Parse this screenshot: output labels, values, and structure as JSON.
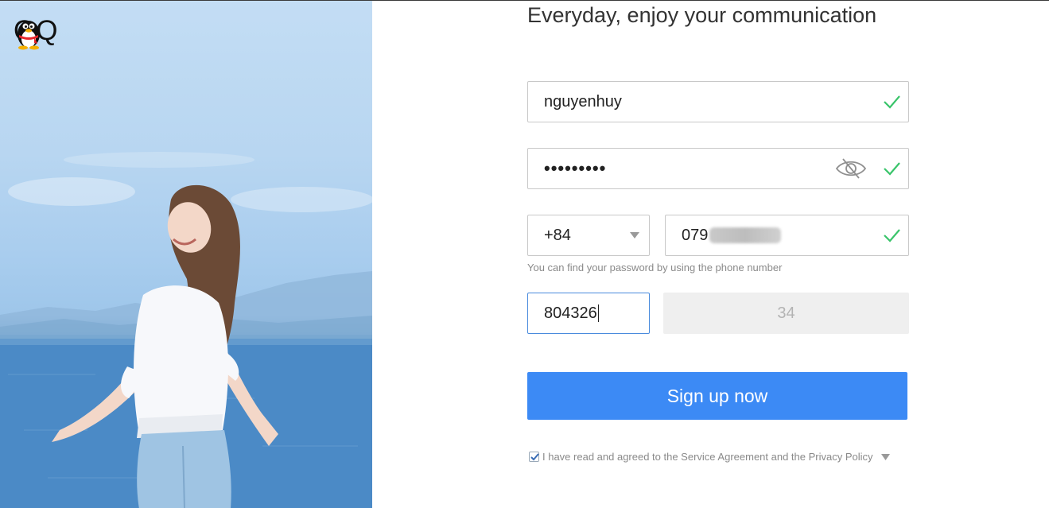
{
  "brand": {
    "name": "QQ",
    "logo_icon": "qq-penguin-icon"
  },
  "headline": "Everyday, enjoy your communication",
  "form": {
    "username": {
      "value": "nguyenhuy",
      "valid": true
    },
    "password": {
      "value": "•••••••••",
      "valid": true,
      "toggle_icon": "eye-off-icon"
    },
    "country_code": {
      "selected": "+84"
    },
    "phone": {
      "value": "079",
      "redacted": true,
      "valid": true
    },
    "phone_hint": "You can find your password by using the phone number",
    "verification_code": {
      "value": "804326"
    },
    "resend_countdown": "34",
    "submit_label": "Sign up now",
    "agreement": {
      "checked": true,
      "text": "I have read and agreed to the Service Agreement and the Privacy Policy"
    }
  },
  "colors": {
    "accent": "#3c8af5",
    "valid_check": "#39c46a",
    "focus_border": "#4a8bdd"
  }
}
